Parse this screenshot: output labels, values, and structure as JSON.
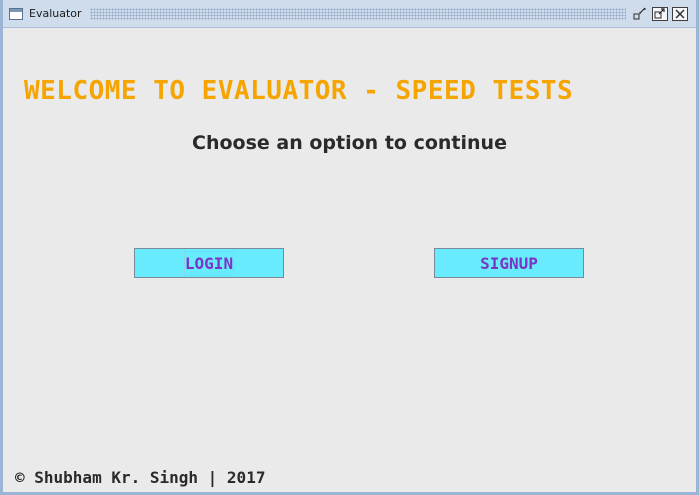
{
  "window": {
    "title": "Evaluator",
    "controls": {
      "restore_icon": "restore-icon",
      "maximize_icon": "maximize-icon",
      "close_icon": "close-icon"
    }
  },
  "main": {
    "heading": "WELCOME TO EVALUATOR - SPEED TESTS",
    "subheading": "Choose an option to continue",
    "buttons": {
      "login_label": "LOGIN",
      "signup_label": "SIGNUP"
    },
    "footer": "© Shubham Kr. Singh | 2017"
  },
  "colors": {
    "heading": "#f5a400",
    "button_bg": "#68ecfd",
    "button_text": "#7a35c8",
    "background": "#eaeaea",
    "titlebar": "#cfdcec"
  }
}
